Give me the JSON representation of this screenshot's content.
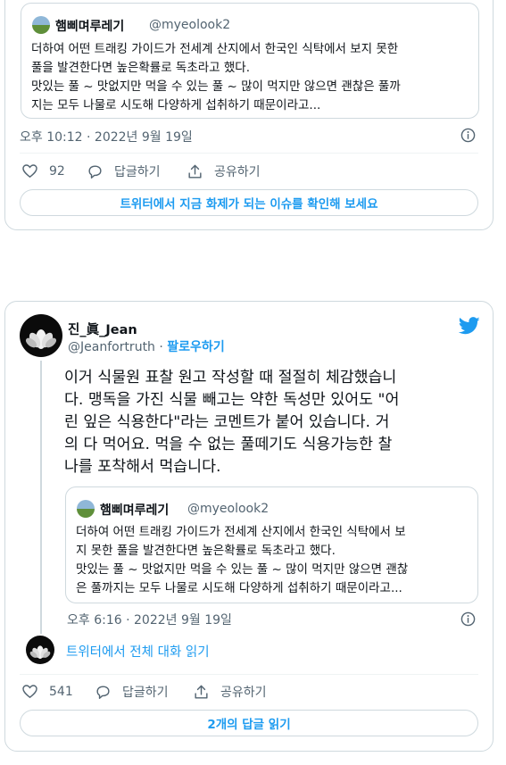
{
  "tweet1": {
    "quote": {
      "author_name": "햄삐며루레기",
      "author_handle": "@myeolook2",
      "text": "더하여 어떤 트래킹 가이드가 전세계 산지에서 한국인 식탁에서 보지 못한\n풀을 발견한다면 높은확률로 독초라고 했다.\n맛있는 풀 ~ 맛없지만 먹을 수 있는 풀 ~ 많이 먹지만 않으면 괜찮은 풀까\n지는 모두 나물로 시도해 다양하게 섭취하기 때문이라고..."
    },
    "timestamp": "오후 10:12 · 2022년 9월 19일",
    "likes": "92",
    "reply_label": "답글하기",
    "share_label": "공유하기",
    "trending_button": "트위터에서 지금 화제가 되는 이슈를 확인해 보세요"
  },
  "tweet2": {
    "author_name": "진_眞_Jean",
    "author_handle": "@Jeanfortruth",
    "separator": "·",
    "follow_label": "팔로우하기",
    "text": "이거 식물원 표찰 원고 작성할 때 절절히 체감했습니\n다. 맹독을 가진 식물 빼고는 약한 독성만 있어도 \"어\n린 잎은 식용한다\"라는 코멘트가 붙어 있습니다. 거\n의 다 먹어요. 먹을 수 없는 풀떼기도 식용가능한 찰\n나를 포착해서 먹습니다.",
    "quote": {
      "author_name": "햄삐며루레기",
      "author_handle": "@myeolook2",
      "text": "더하여 어떤 트래킹 가이드가 전세계 산지에서 한국인 식탁에서 보\n지 못한 풀을 발견한다면 높은확률로 독초라고 했다.\n맛있는 풀 ~ 맛없지만 먹을 수 있는 풀 ~ 많이 먹지만 않으면 괜찮\n은 풀까지는 모두 나물로 시도해 다양하게 섭취하기 때문이라고..."
    },
    "timestamp": "오후 6:16 · 2022년 9월 19일",
    "full_thread_label": "트위터에서 전체 대화 읽기",
    "likes": "541",
    "reply_label": "답글하기",
    "share_label": "공유하기",
    "read_replies_button": "2개의 답글 읽기"
  },
  "colors": {
    "accent": "#1d9bf0",
    "secondary_text": "#536471",
    "border": "#cfd9de"
  }
}
